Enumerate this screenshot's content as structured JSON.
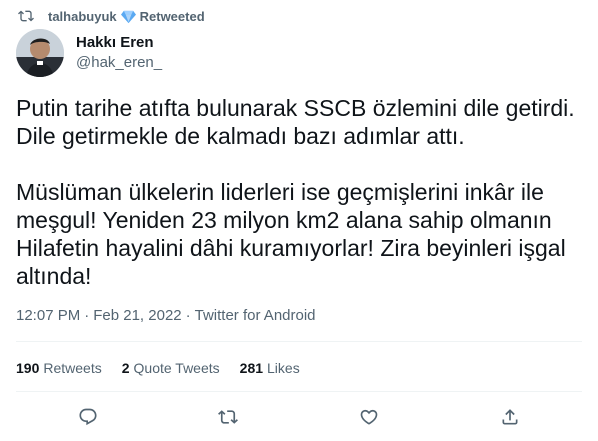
{
  "retweet": {
    "username": "talhabuyuk",
    "label": "Retweeted",
    "icon": "retweet-icon",
    "verified_icon": "verified-diamond-icon"
  },
  "author": {
    "display_name": "Hakkı Eren",
    "handle": "@hak_eren_"
  },
  "tweet": {
    "text": "Putin tarihe atıfta bulunarak SSCB özlemini dile getirdi. Dile getirmekle de kalmadı bazı adımlar attı.\n\nMüslüman ülkelerin liderleri ise geçmişlerini inkâr ile meşgul! Yeniden 23 milyon km2 alana sahip olmanın Hilafetin hayalini dâhi kuramıyorlar! Zira beyinleri işgal altında!",
    "time": "12:07 PM",
    "separator": "·",
    "date": "Feb 21, 2022",
    "source": "Twitter for Android"
  },
  "stats": {
    "retweets_count": "190",
    "retweets_label": "Retweets",
    "quotes_count": "2",
    "quotes_label": "Quote Tweets",
    "likes_count": "281",
    "likes_label": "Likes"
  },
  "actions": {
    "reply_icon": "reply-icon",
    "retweet_icon": "retweet-icon",
    "like_icon": "heart-icon",
    "share_icon": "share-icon"
  },
  "colors": {
    "primary_text": "#0f1419",
    "secondary_text": "#536471",
    "divider": "#eff3f4",
    "verified_blue": "#5aa9f2"
  }
}
